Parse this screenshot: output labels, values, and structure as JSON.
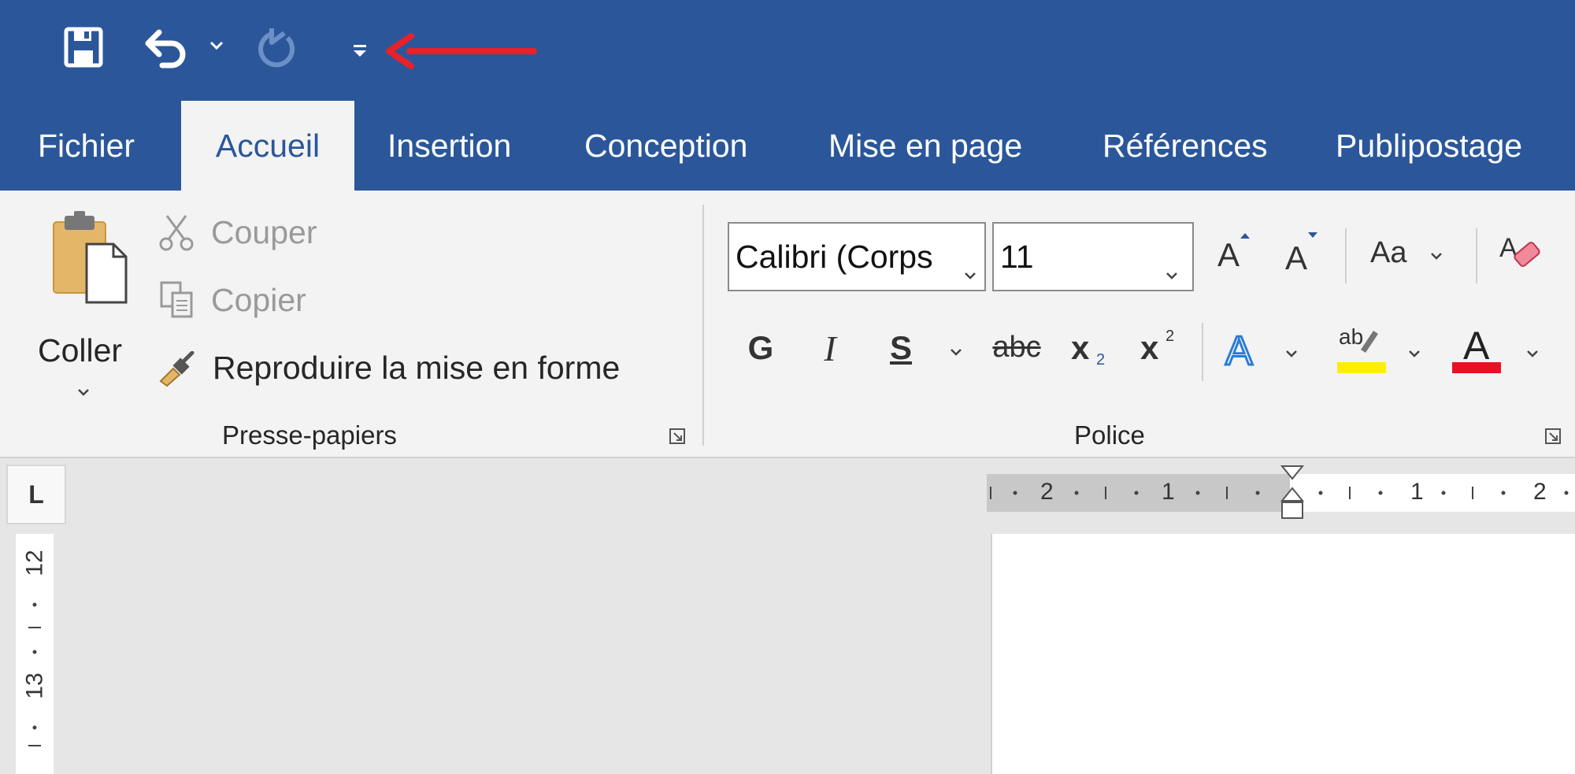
{
  "quick_access": {
    "save_icon": "save-icon",
    "undo_icon": "undo-icon",
    "undo_dropdown_icon": "chevron-down-icon",
    "redo_icon": "redo-icon",
    "customize_icon": "customize-quick-access-icon",
    "annotation_arrow_color": "#e8212b"
  },
  "tabs": [
    {
      "label": "Fichier"
    },
    {
      "label": "Accueil",
      "active": true
    },
    {
      "label": "Insertion"
    },
    {
      "label": "Conception"
    },
    {
      "label": "Mise en page"
    },
    {
      "label": "Références"
    },
    {
      "label": "Publipostage"
    }
  ],
  "clipboard": {
    "paste_label": "Coller",
    "cut_label": "Couper",
    "copy_label": "Copier",
    "format_painter_label": "Reproduire la mise en forme",
    "group_label": "Presse-papiers"
  },
  "font": {
    "font_name": "Calibri (Corps",
    "font_size": "11",
    "grow_label": "A",
    "shrink_label": "A",
    "case_label": "Aa",
    "bold_label": "G",
    "italic_label": "I",
    "underline_label": "S",
    "strike_label": "abc",
    "subscript_base": "x",
    "subscript_sub": "2",
    "superscript_base": "x",
    "superscript_sup": "2",
    "effects_label": "A",
    "highlight_label": "ab",
    "font_color_label": "A",
    "group_label": "Police",
    "highlight_color": "#ffee00",
    "font_color": "#e81123"
  },
  "ruler": {
    "tab_selector": "L",
    "horizontal_ticks": [
      "2",
      "1",
      "1",
      "2"
    ],
    "vertical_ticks": [
      "12",
      "13"
    ]
  },
  "colors": {
    "title_bar": "#2b579a",
    "ribbon": "#f3f3f3",
    "workspace": "#e6e6e6"
  }
}
